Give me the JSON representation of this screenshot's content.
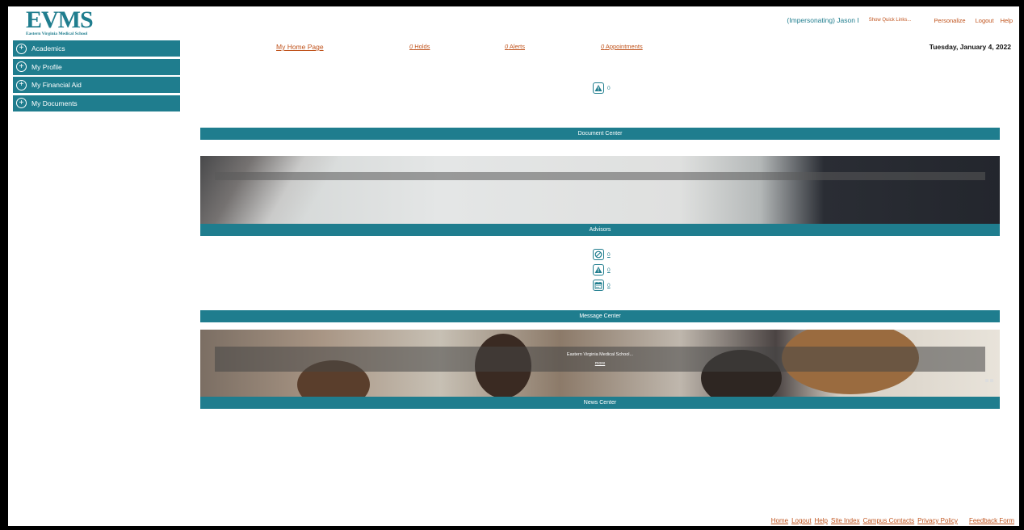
{
  "logo": {
    "big": "EVMS",
    "small": "Eastern Virginia Medical School"
  },
  "header": {
    "impersonating": "(Impersonating) Jason I",
    "quick_links": "Show Quick Links...",
    "personalize": "Personalize",
    "logout": "Logout",
    "help": "Help"
  },
  "sidebar": {
    "items": [
      {
        "label": "Academics"
      },
      {
        "label": "My Profile"
      },
      {
        "label": "My Financial Aid"
      },
      {
        "label": "My Documents"
      }
    ]
  },
  "topnav": {
    "home": "My Home Page",
    "holds_count": "0",
    "holds_label": " Holds",
    "alerts_count": "0",
    "alerts_label": " Alerts",
    "appointments_count": "0",
    "appointments_label": " Appointments"
  },
  "date": "Tuesday, January 4, 2022",
  "top_alert_count": "0",
  "sections": {
    "document_center": "Document Center",
    "advisors": "Advisors",
    "message_center": "Message Center",
    "news_center": "News Center"
  },
  "advisors_counts": {
    "holds": "0",
    "alerts": "0",
    "appointments": "0"
  },
  "news": {
    "headline": "Eastern Virginia Medical School...",
    "more": "more"
  },
  "footer": {
    "home": "Home",
    "logout": "Logout",
    "help": "Help",
    "site_index": "Site Index",
    "campus_contacts": "Campus Contacts",
    "privacy": "Privacy Policy",
    "feedback": "Feedback Form"
  },
  "colors": {
    "teal": "#1f7d8e",
    "link": "#c0531c"
  }
}
